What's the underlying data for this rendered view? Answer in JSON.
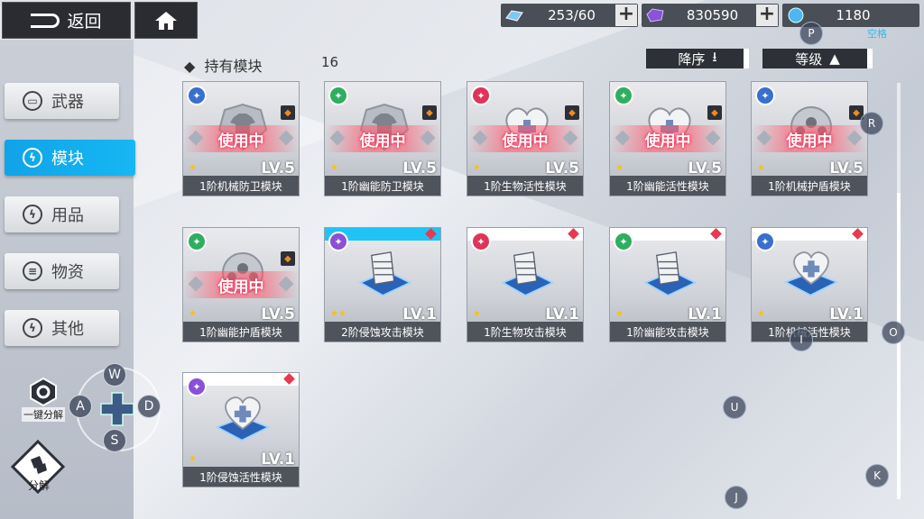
{
  "topbar": {
    "back_label": "返回",
    "resources": [
      {
        "icon": "stamina-icon",
        "value": "253/60"
      },
      {
        "icon": "crystal-icon",
        "value": "830590"
      },
      {
        "icon": "gear-chip-icon",
        "value": "1180"
      }
    ]
  },
  "sidebar": {
    "items": [
      {
        "label": "武器",
        "icon": "gun-icon",
        "active": false
      },
      {
        "label": "模块",
        "icon": "bolt-icon",
        "active": true
      },
      {
        "label": "用品",
        "icon": "bolt-icon",
        "active": false
      },
      {
        "label": "物资",
        "icon": "stack-icon",
        "active": false
      },
      {
        "label": "其他",
        "icon": "bolt-icon",
        "active": false
      }
    ],
    "disassemble_all_label": "一键分解",
    "disassemble_label": "分解"
  },
  "header": {
    "section_title": "持有模块",
    "count": "16",
    "sort_order_label": "降序",
    "sort_key_label": "等级"
  },
  "status_label": "使用中",
  "cards": [
    {
      "name": "1阶机械防卫模块",
      "level": "LV.5",
      "stars": 1,
      "in_use": true,
      "type_color": "#3a6fd0",
      "art": "shirt"
    },
    {
      "name": "1阶幽能防卫模块",
      "level": "LV.5",
      "stars": 1,
      "in_use": true,
      "type_color": "#2fae62",
      "art": "shirt"
    },
    {
      "name": "1阶生物活性模块",
      "level": "LV.5",
      "stars": 1,
      "in_use": true,
      "type_color": "#e0335a",
      "art": "heart"
    },
    {
      "name": "1阶幽能活性模块",
      "level": "LV.5",
      "stars": 1,
      "in_use": true,
      "type_color": "#2fae62",
      "art": "heart"
    },
    {
      "name": "1阶机械护盾模块",
      "level": "LV.5",
      "stars": 1,
      "in_use": true,
      "type_color": "#3a6fd0",
      "art": "ball"
    },
    {
      "name": "1阶幽能护盾模块",
      "level": "LV.5",
      "stars": 1,
      "in_use": true,
      "type_color": "#2fae62",
      "art": "ball"
    },
    {
      "name": "2阶侵蚀攻击模块",
      "level": "LV.1",
      "stars": 2,
      "in_use": false,
      "type_color": "#8a4fd8",
      "art": "missile",
      "blue": true
    },
    {
      "name": "1阶生物攻击模块",
      "level": "LV.1",
      "stars": 1,
      "in_use": false,
      "type_color": "#e0335a",
      "art": "missile"
    },
    {
      "name": "1阶幽能攻击模块",
      "level": "LV.1",
      "stars": 1,
      "in_use": false,
      "type_color": "#2fae62",
      "art": "missile"
    },
    {
      "name": "1阶机械活性模块",
      "level": "LV.1",
      "stars": 1,
      "in_use": false,
      "type_color": "#3a6fd0",
      "art": "heart"
    },
    {
      "name": "1阶侵蚀活性模块",
      "level": "LV.1",
      "stars": 1,
      "in_use": false,
      "type_color": "#8a4fd8",
      "art": "heart"
    }
  ],
  "keys": [
    "P",
    "空格",
    "R",
    "I",
    "O",
    "U",
    "K",
    "J"
  ],
  "dpad": {
    "up": "W",
    "left": "A",
    "right": "D",
    "down": "S"
  }
}
